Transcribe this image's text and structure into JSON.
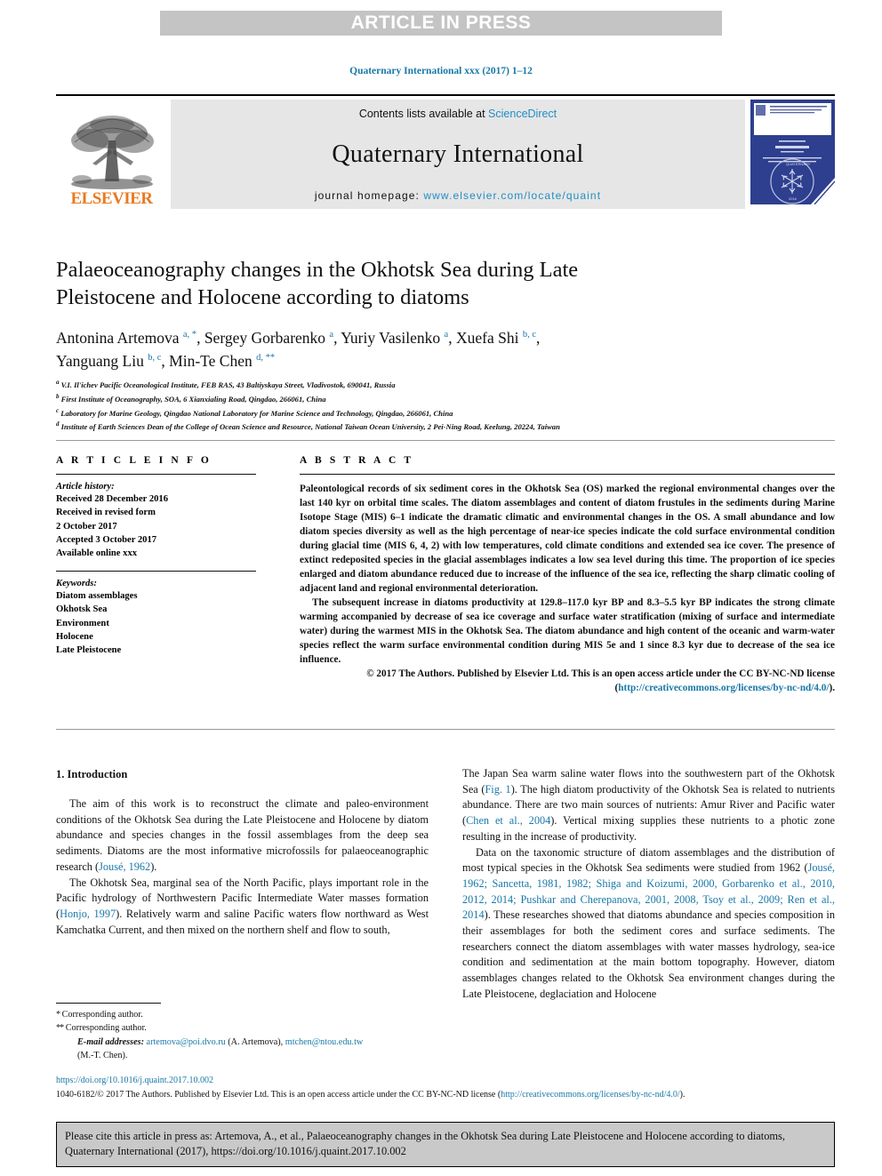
{
  "banner": {
    "text": "ARTICLE IN PRESS"
  },
  "journal_ref": "Quaternary International xxx (2017) 1–12",
  "masthead": {
    "elsevier_wordmark": "ELSEVIER",
    "contents_prefix": "Contents lists available at ",
    "contents_link": "ScienceDirect",
    "journal_title": "Quaternary International",
    "homepage_label": "journal homepage: ",
    "homepage_url": "www.elsevier.com/locate/quaint"
  },
  "article": {
    "title": "Palaeoceanography changes in the Okhotsk Sea during Late Pleistocene and Holocene according to diatoms",
    "authors_line1_a": "Antonina Artemova ",
    "authors_line1_a_sup": "a, *",
    "authors_line1_b": ", Sergey Gorbarenko ",
    "authors_line1_b_sup": "a",
    "authors_line1_c": ", Yuriy Vasilenko ",
    "authors_line1_c_sup": "a",
    "authors_line1_d": ", Xuefa Shi ",
    "authors_line1_d_sup": "b, c",
    "authors_line1_e": ",",
    "authors_line2_a": "Yanguang Liu ",
    "authors_line2_a_sup": "b, c",
    "authors_line2_b": ", Min-Te Chen ",
    "authors_line2_b_sup": "d, **",
    "affiliations": [
      {
        "mark": "a",
        "text": "V.I. Il'ichev Pacific Oceanological Institute, FEB RAS, 43 Baltiyskaya Street, Vladivostok, 690041, Russia"
      },
      {
        "mark": "b",
        "text": "First Institute of Oceanography, SOA, 6 Xianxialing Road, Qingdao, 266061, China"
      },
      {
        "mark": "c",
        "text": "Laboratory for Marine Geology, Qingdao National Laboratory for Marine Science and Technology, Qingdao, 266061, China"
      },
      {
        "mark": "d",
        "text": "Institute of Earth Sciences Dean of the College of Ocean Science and Resource, National Taiwan Ocean University, 2 Pei-Ning Road, Keelung, 20224, Taiwan"
      }
    ]
  },
  "article_info": {
    "heading": "A R T I C L E   I N F O",
    "history_label": "Article history:",
    "history": [
      "Received 28 December 2016",
      "Received in revised form",
      "2 October 2017",
      "Accepted 3 October 2017",
      "Available online xxx"
    ],
    "keywords_label": "Keywords:",
    "keywords": [
      "Diatom assemblages",
      "Okhotsk Sea",
      "Environment",
      "Holocene",
      "Late Pleistocene"
    ]
  },
  "abstract": {
    "heading": "A B S T R A C T",
    "p1": "Paleontological records of six sediment cores in the Okhotsk Sea (OS) marked the regional environmental changes over the last 140 kyr on orbital time scales. The diatom assemblages and content of diatom frustules in the sediments during Marine Isotope Stage (MIS) 6–1 indicate the dramatic climatic and environmental changes in the OS. A small abundance and low diatom species diversity as well as the high percentage of near-ice species indicate the cold surface environmental condition during glacial time (MIS 6, 4, 2) with low temperatures, cold climate conditions and extended sea ice cover. The presence of extinct redeposited species in the glacial assemblages indicates a low sea level during this time. The proportion of ice species enlarged and diatom abundance reduced due to increase of the influence of the sea ice, reflecting the sharp climatic cooling of adjacent land and regional environmental deterioration.",
    "p2": "The subsequent increase in diatoms productivity at 129.8–117.0 kyr BP and 8.3–5.5 kyr BP indicates the strong climate warming accompanied by decrease of sea ice coverage and surface water stratification (mixing of surface and intermediate water) during the warmest MIS in the Okhotsk Sea. The diatom abundance and high content of the oceanic and warm-water species reflect the warm surface environmental condition during MIS 5e and 1 since 8.3 kyr due to decrease of the sea ice influence.",
    "copyright_before": "© 2017 The Authors. Published by Elsevier Ltd. This is an open access article under the CC BY-NC-ND license (",
    "copyright_link": "http://creativecommons.org/licenses/by-nc-nd/4.0/",
    "copyright_after": ")."
  },
  "intro": {
    "heading": "1. Introduction",
    "left": {
      "p1_a": "The aim of this work is to reconstruct the climate and paleo-environment conditions of the Okhotsk Sea during the Late Pleistocene and Holocene by diatom abundance and species changes in the fossil assemblages from the deep sea sediments. Diatoms are the most informative microfossils for palaeoceanographic research (",
      "p1_cite": "Jousé, 1962",
      "p1_b": ").",
      "p2_a": "The Okhotsk Sea, marginal sea of the North Pacific, plays important role in the Pacific hydrology of Northwestern Pacific Intermediate Water masses formation (",
      "p2_cite": "Honjo, 1997",
      "p2_b": "). Relatively warm and saline Pacific waters flow northward as West Kamchatka Current, and then mixed on the northern shelf and flow to south,"
    },
    "right": {
      "p1_a": "The Japan Sea warm saline water flows into the southwestern part of the Okhotsk Sea (",
      "p1_cite1": "Fig. 1",
      "p1_b": "). The high diatom productivity of the Okhotsk Sea is related to nutrients abundance. There are two main sources of nutrients: Amur River and Pacific water (",
      "p1_cite2": "Chen et al., 2004",
      "p1_c": "). Vertical mixing supplies these nutrients to a photic zone resulting in the increase of productivity.",
      "p2_a": "Data on the taxonomic structure of diatom assemblages and the distribution of most typical species in the Okhotsk Sea sediments were studied from 1962 (",
      "p2_cite": "Jousé, 1962; Sancetta, 1981, 1982; Shiga and Koizumi, 2000, Gorbarenko et al., 2010, 2012, 2014; Pushkar and Cherepanova, 2001, 2008, Tsoy et al., 2009; Ren et al., 2014",
      "p2_b": "). These researches showed that diatoms abundance and species composition in their assemblages for both the sediment cores and surface sediments. The researchers connect the diatom assemblages with water masses hydrology, sea-ice condition and sedimentation at the main bottom topography. However, diatom assemblages changes related to the Okhotsk Sea environment changes during the Late Pleistocene, deglaciation and Holocene"
    }
  },
  "footnotes": {
    "star1": "*",
    "corresponding1": " Corresponding author.",
    "star2": "**",
    "corresponding2": " Corresponding author.",
    "email_label": "E-mail addresses:",
    "email1": "artemova@poi.dvo.ru",
    "email1_owner": " (A. Artemova), ",
    "email2": "mtchen@ntou.edu.tw",
    "email2_owner": "(M.-T. Chen)."
  },
  "footer": {
    "doi": "https://doi.org/10.1016/j.quaint.2017.10.002",
    "issn_before": "1040-6182/© 2017 The Authors. Published by Elsevier Ltd. This is an open access article under the CC BY-NC-ND license (",
    "issn_link": "http://creativecommons.org/licenses/by-nc-nd/4.0/",
    "issn_after": ")."
  },
  "cite_box": {
    "text": "Please cite this article in press as: Artemova, A., et al., Palaeoceanography changes in the Okhotsk Sea during Late Pleistocene and Holocene according to diatoms, Quaternary International (2017), https://doi.org/10.1016/j.quaint.2017.10.002"
  },
  "colors": {
    "link": "#1878a8",
    "elsevier_orange": "#e87a22",
    "banner_grey": "#c4c4c4",
    "masthead_grey": "#e6e6e6",
    "cover_blue": "#2e3f8f"
  }
}
